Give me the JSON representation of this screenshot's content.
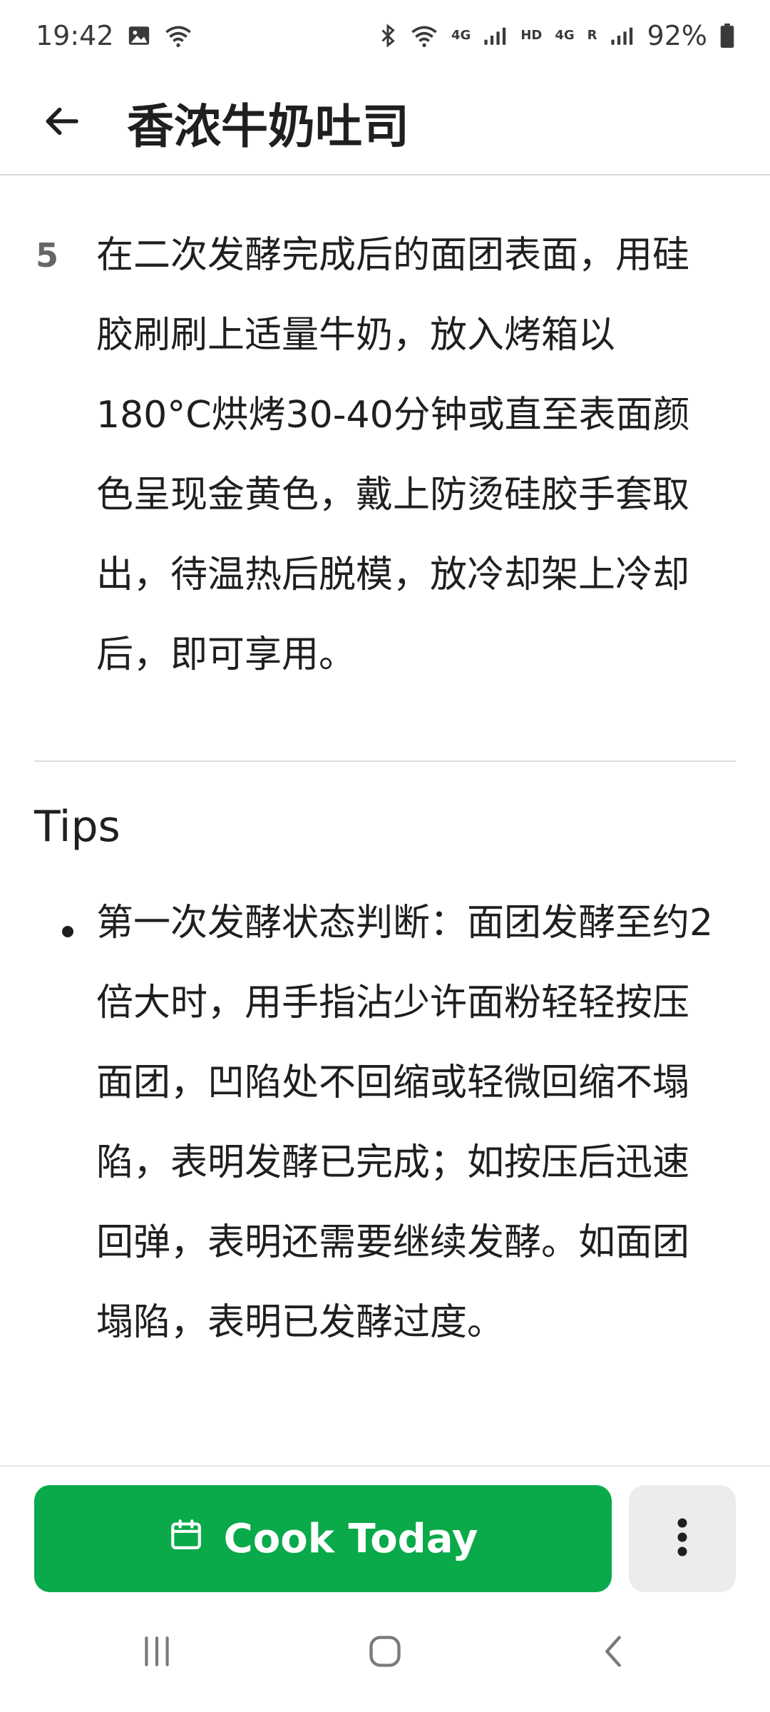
{
  "status_bar": {
    "time": "19:42",
    "net_label": "4G",
    "hd_label": "HD",
    "net2_label": "4G",
    "roaming_label": "R",
    "battery": "92%",
    "icons": [
      "image-icon",
      "wifi-call-icon",
      "bluetooth-icon",
      "wifi-icon",
      "signal-icon",
      "battery-icon"
    ]
  },
  "app_bar": {
    "title": "香浓牛奶吐司",
    "back_icon": "arrow-left-icon"
  },
  "step": {
    "number": "5",
    "text": "在二次发酵完成后的面团表面，用硅胶刷刷上适量牛奶，放入烤箱以180°C烘烤30-40分钟或直至表面颜色呈现金黄色，戴上防烫硅胶手套取出，待温热后脱模，放冷却架上冷却后，即可享用。"
  },
  "tips": {
    "heading": "Tips",
    "items": [
      "第一次发酵状态判断：面团发酵至约2倍大时，用手指沾少许面粉轻轻按压面团，凹陷处不回缩或轻微回缩不塌陷，表明发酵已完成；如按压后迅速回弹，表明还需要继续发酵。如面团塌陷，表明已发酵过度。"
    ]
  },
  "actions": {
    "cook_today_label": "Cook Today",
    "cook_icon": "calendar-icon",
    "more_icon": "more-vertical-icon",
    "button_color": "#0aa94a"
  },
  "nav_bar": {
    "icons": [
      "recent-apps-icon",
      "home-icon",
      "back-icon"
    ]
  }
}
